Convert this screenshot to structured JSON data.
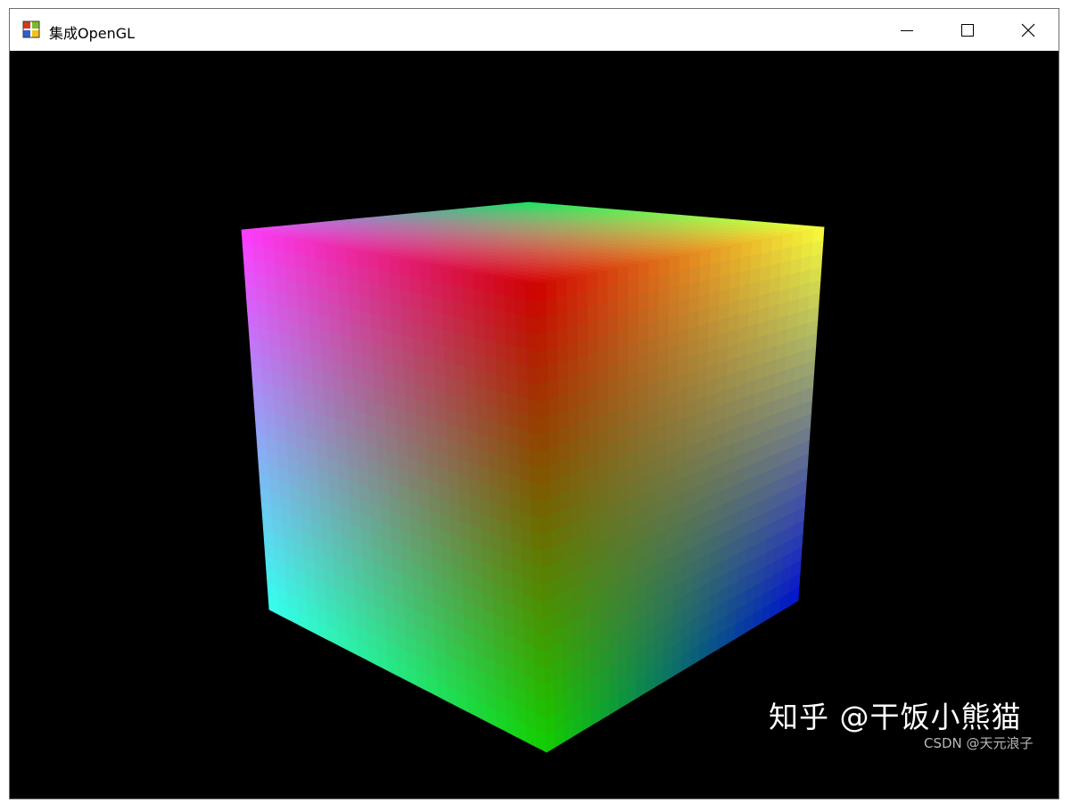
{
  "window": {
    "title": "集成OpenGL",
    "icon": "opengl-app-icon",
    "controls": [
      "minimize-icon",
      "maximize-icon",
      "close-icon"
    ]
  },
  "scene": {
    "background": "#000000",
    "object": "rgb-color-cube",
    "vertex_colors": {
      "top_back": "#19e060",
      "top_left": "#ff3cff",
      "top_center": "#d00000",
      "top_right": "#f8ff3a",
      "bottom_left": "#35fff0",
      "bottom_center": "#10d000",
      "bottom_right": "#0010d0"
    }
  },
  "watermarks": {
    "main": "知乎 @干饭小熊猫",
    "sub": "CSDN @天元浪子"
  }
}
